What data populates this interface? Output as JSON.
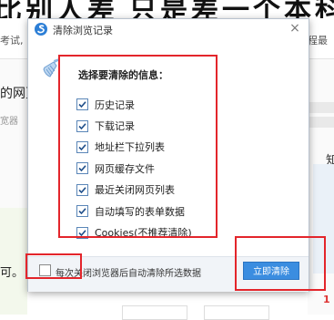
{
  "background": {
    "headline_left": "比别人差",
    "headline_right": "只是差一个本科",
    "topbar_left_text": "考试,",
    "topbar_right_text": "程最",
    "left_title": "的网页",
    "left_small": "宽器",
    "left_bottom_text": "可。",
    "right_char": "知",
    "right_num": "1"
  },
  "dialog": {
    "title": "清除浏览记录",
    "close_glyph": "×",
    "question": "选择要清除的信息：",
    "options": [
      {
        "label": "历史记录",
        "checked": true
      },
      {
        "label": "下载记录",
        "checked": true
      },
      {
        "label": "地址栏下拉列表",
        "checked": true
      },
      {
        "label": "网页缓存文件",
        "checked": true
      },
      {
        "label": "最近关闭网页列表",
        "checked": true
      },
      {
        "label": "自动填写的表单数据",
        "checked": true
      },
      {
        "label": "Cookies(不推荐清除)",
        "checked": true
      }
    ],
    "auto_clear_label": "每次关闭浏览器后自动清除所选数据",
    "auto_clear_checked": false,
    "clear_button": "立即清除"
  },
  "colors": {
    "accent": "#3b8de0",
    "annotation": "#e3252b"
  },
  "icons": {
    "logo": "browser-logo-icon",
    "close": "close-icon",
    "broom": "broom-icon",
    "check": "checkmark-icon"
  }
}
